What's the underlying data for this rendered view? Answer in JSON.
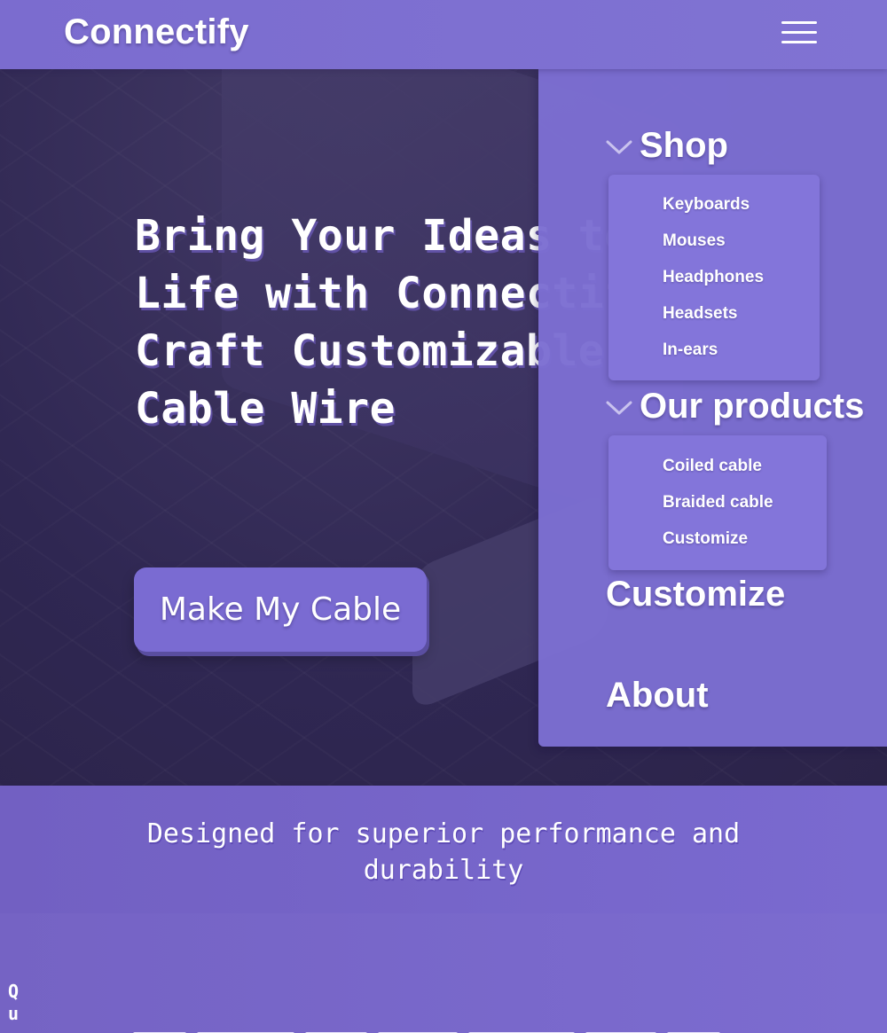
{
  "header": {
    "brand": "Connectify",
    "menu_icon": "hamburger-menu-icon"
  },
  "hero": {
    "title": "Bring Your Ideas to\nLife with Connectify:\nCraft Customizable\nCable Wire",
    "cta_label": "Make My Cable"
  },
  "nav": {
    "shop": {
      "label": "Shop",
      "icon": "chevron-down-icon",
      "items": [
        "Keyboards",
        "Mouses",
        "Headphones",
        "Headsets",
        "In-ears"
      ]
    },
    "products": {
      "label": "Our products",
      "icon": "chevron-down-icon",
      "items": [
        "Coiled cable",
        "Braided cable",
        "Customize"
      ]
    },
    "customize": {
      "label": "Customize"
    },
    "about": {
      "label": "About"
    }
  },
  "banner": {
    "text": "Designed for superior performance and durability"
  },
  "lower": {
    "vertical_text": "Qu"
  },
  "colors": {
    "accent": "#7b6ccf",
    "hero_bg": "#322a55",
    "submenu_bg": "#8375da",
    "text": "#ffffff"
  }
}
